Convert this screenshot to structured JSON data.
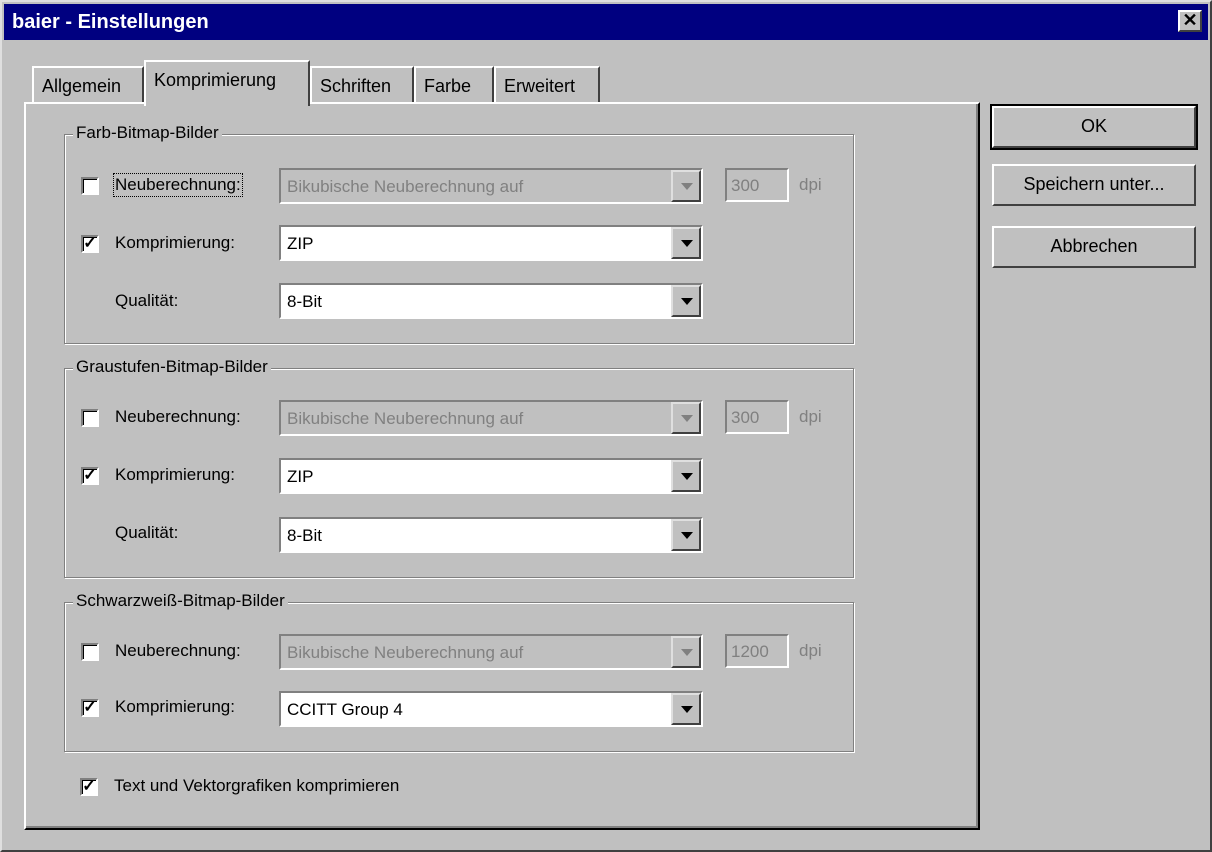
{
  "window": {
    "title": "baier - Einstellungen",
    "close_glyph": "✕"
  },
  "tabs": [
    {
      "label": "Allgemein"
    },
    {
      "label": "Komprimierung",
      "active": true
    },
    {
      "label": "Schriften"
    },
    {
      "label": "Farbe"
    },
    {
      "label": "Erweitert"
    }
  ],
  "groups": {
    "color": {
      "title": "Farb-Bitmap-Bilder",
      "resample_label": "Neuberechnung:",
      "resample_checked": false,
      "resample_method": "Bikubische Neuberechnung auf",
      "resolution": "300",
      "unit": "dpi",
      "compression_label": "Komprimierung:",
      "compression_checked": true,
      "compression": "ZIP",
      "quality_label": "Qualität:",
      "quality": "8-Bit"
    },
    "gray": {
      "title": "Graustufen-Bitmap-Bilder",
      "resample_label": "Neuberechnung:",
      "resample_checked": false,
      "resample_method": "Bikubische Neuberechnung auf",
      "resolution": "300",
      "unit": "dpi",
      "compression_label": "Komprimierung:",
      "compression_checked": true,
      "compression": "ZIP",
      "quality_label": "Qualität:",
      "quality": "8-Bit"
    },
    "mono": {
      "title": "Schwarzweiß-Bitmap-Bilder",
      "resample_label": "Neuberechnung:",
      "resample_checked": false,
      "resample_method": "Bikubische Neuberechnung auf",
      "resolution": "1200",
      "unit": "dpi",
      "compression_label": "Komprimierung:",
      "compression_checked": true,
      "compression": "CCITT Group 4"
    }
  },
  "text_vector": {
    "label": "Text und Vektorgrafiken komprimieren",
    "checked": true
  },
  "buttons": {
    "ok": "OK",
    "save_as": "Speichern unter...",
    "cancel": "Abbrechen"
  },
  "check_glyph": "✓"
}
